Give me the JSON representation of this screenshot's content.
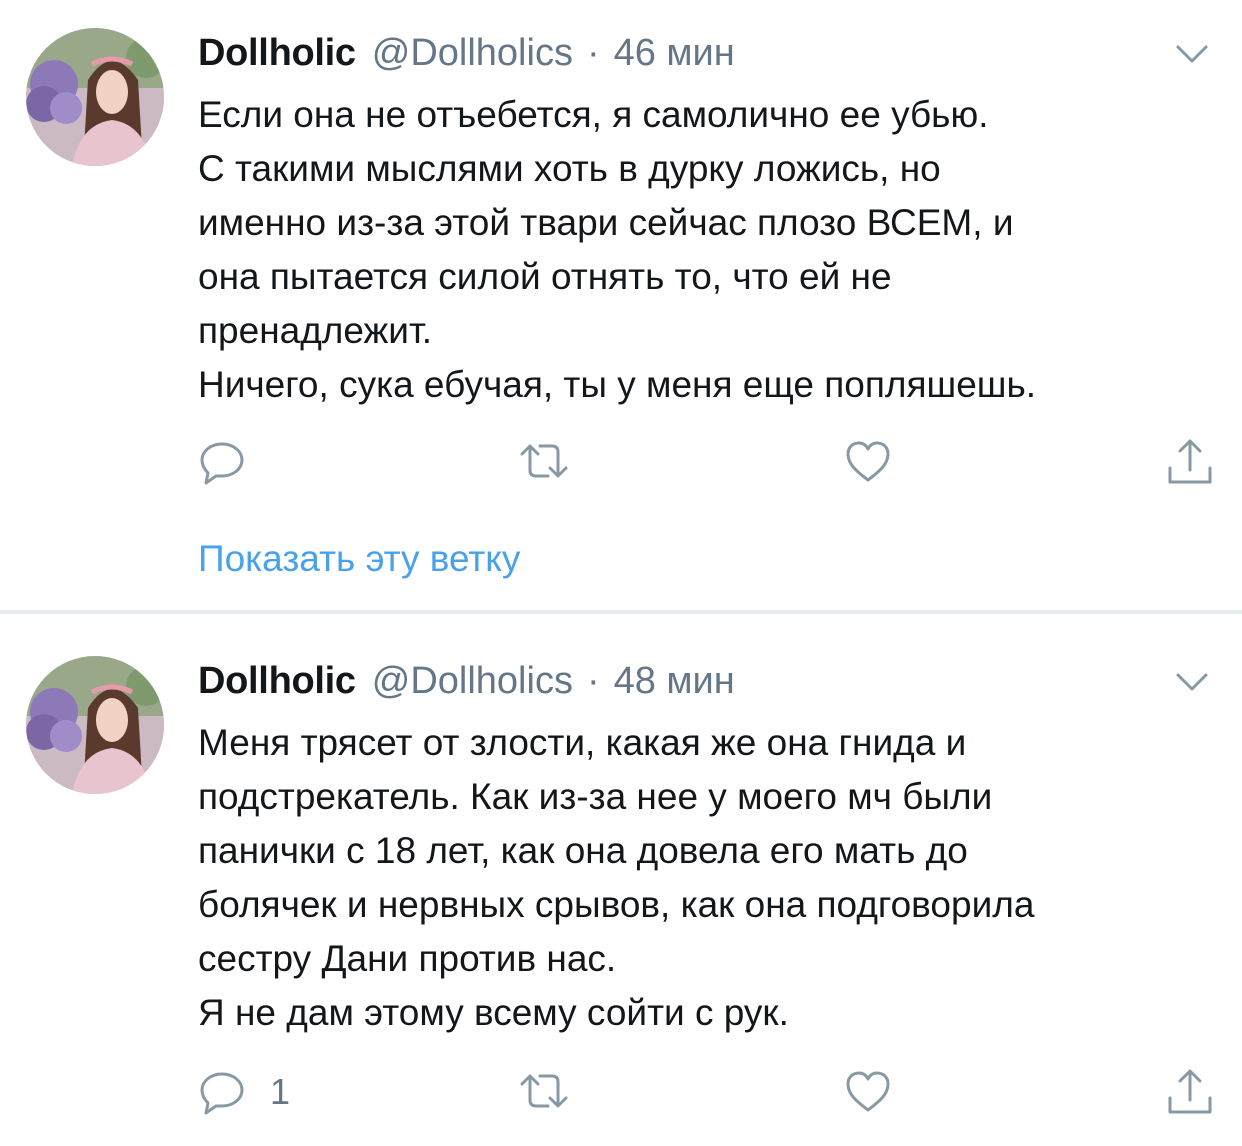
{
  "tweets": [
    {
      "display_name": "Dollholic",
      "handle": "@Dollholics",
      "separator": "·",
      "time": "46 мин",
      "text_lines": [
        "Если она не отъебется, я самолично ее убью.",
        "С такими мыслями хоть в дурку ложись, но",
        "именно из-за этой твари сейчас плозо ВСЕМ, и",
        "она пытается силой отнять то, что ей не",
        "пренадлежит.",
        "Ничего, сука ебучая, ты у меня еще попляшешь."
      ],
      "reply_count": "",
      "show_thread": "Показать эту ветку"
    },
    {
      "display_name": "Dollholic",
      "handle": "@Dollholics",
      "separator": "·",
      "time": "48 мин",
      "text_lines": [
        "Меня трясет от злости, какая же она гнида и",
        "подстрекатель. Как из-за нее у моего мч были",
        "панички с 18 лет, как она довела его мать до",
        "болячек и нервных срывов,  как она подговорила",
        "сестру Дани против нас.",
        "Я не дам этому всему сойти с рук."
      ],
      "reply_count": "1"
    }
  ],
  "icons": {
    "menu": "chevron-down-icon",
    "reply": "reply-icon",
    "retweet": "retweet-icon",
    "like": "heart-icon",
    "share": "share-icon"
  },
  "colors": {
    "text": "#14171a",
    "secondary": "#657786",
    "link": "#4aa1eb",
    "divider": "#e6ecf0"
  }
}
